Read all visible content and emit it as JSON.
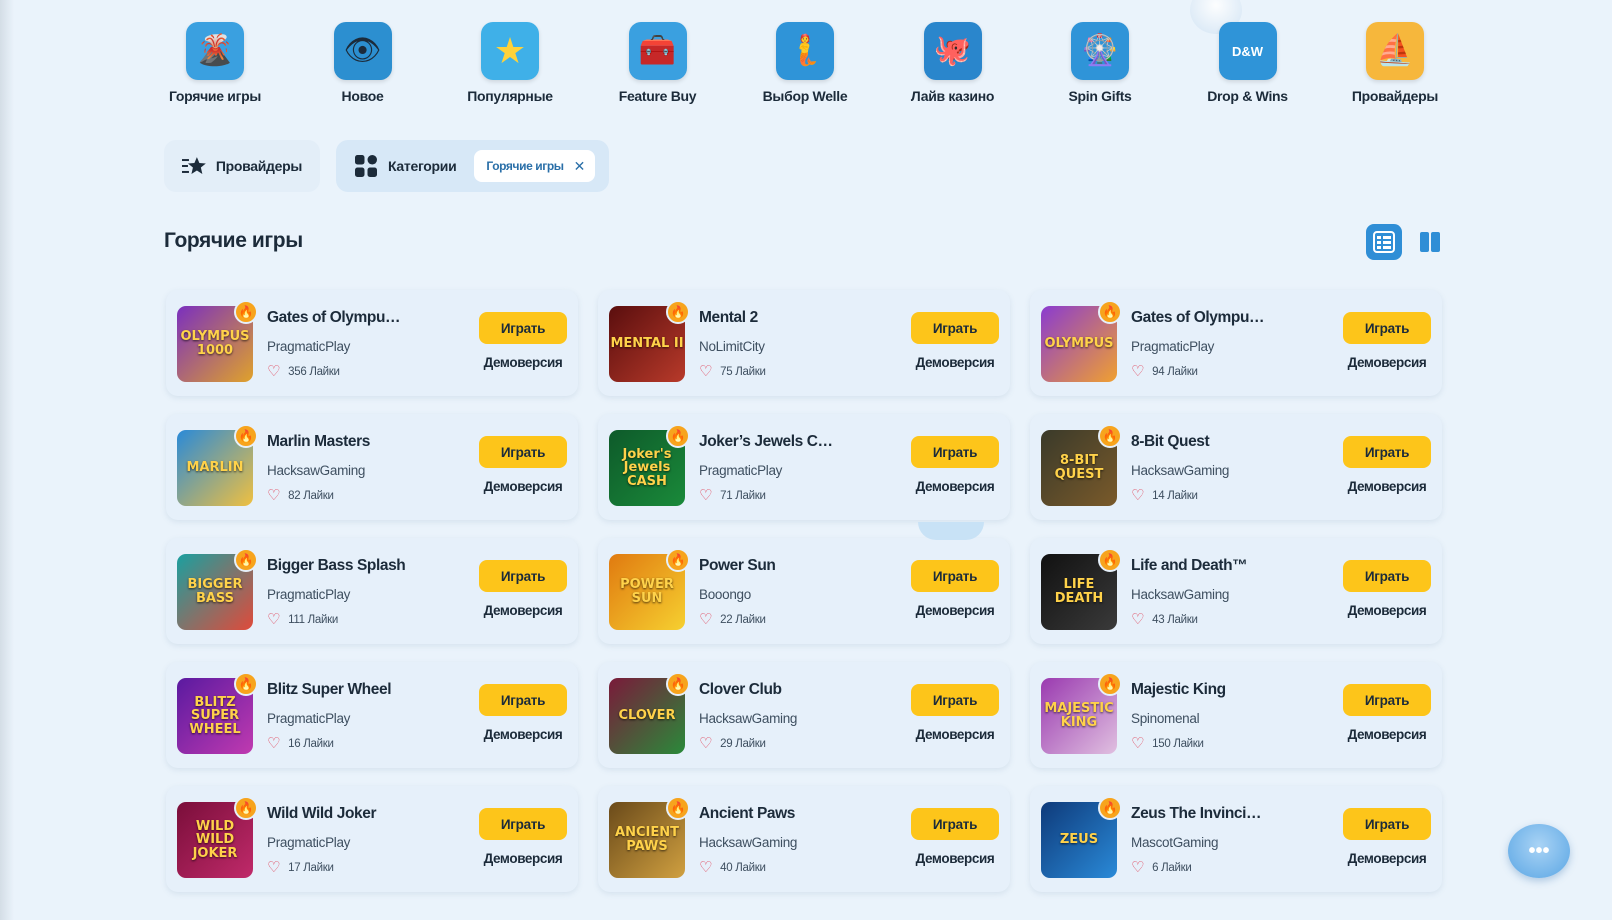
{
  "categories": [
    {
      "label": "Горячие игры",
      "icon": "volcano-icon",
      "glyph": "🌋",
      "bg": "#3aa0e0"
    },
    {
      "label": "Новое",
      "icon": "eye-icon",
      "glyph": "👁",
      "bg": "#2c8fd0"
    },
    {
      "label": "Популярные",
      "icon": "star-icon",
      "glyph": "★",
      "bg": "#3fb0e8"
    },
    {
      "label": "Feature Buy",
      "icon": "treasure-chest-icon",
      "glyph": "🧰",
      "bg": "#3aa0e0"
    },
    {
      "label": "Выбор Welle",
      "icon": "mermaid-icon",
      "glyph": "🧜",
      "bg": "#2f94d8"
    },
    {
      "label": "Лайв казино",
      "icon": "live-casino-icon",
      "glyph": "🐙",
      "bg": "#2a86cc"
    },
    {
      "label": "Spin Gifts",
      "icon": "wheel-icon",
      "glyph": "🎡",
      "bg": "#2f94d8"
    },
    {
      "label": "Drop & Wins",
      "icon": "drop-wins-icon",
      "glyph": "D&W",
      "bg": "#2f94d8"
    },
    {
      "label": "Провайдеры",
      "icon": "sailboat-icon",
      "glyph": "⛵",
      "bg": "#f6b73c"
    }
  ],
  "filters": {
    "providers_label": "Провайдеры",
    "categories_label": "Категории",
    "active_chip": "Горячие игры"
  },
  "section": {
    "title": "Горячие игры"
  },
  "play_label": "Играть",
  "demo_label": "Демоверсия",
  "games": [
    {
      "title": "Gates of Olympu…",
      "provider": "PragmaticPlay",
      "likes": "356 Лайки",
      "thumb_text": "OLYMPUS 1000",
      "thumb_bg": "linear-gradient(135deg,#7a2fbf,#e0a22a)"
    },
    {
      "title": "Mental 2",
      "provider": "NoLimitCity",
      "likes": "75 Лайки",
      "thumb_text": "MENTAL II",
      "thumb_bg": "linear-gradient(135deg,#5a0e0e,#b83a2a)"
    },
    {
      "title": "Gates of Olympu…",
      "provider": "PragmaticPlay",
      "likes": "94 Лайки",
      "thumb_text": "OLYMPUS",
      "thumb_bg": "linear-gradient(135deg,#8a3bd0,#f0a030)"
    },
    {
      "title": "Marlin Masters",
      "provider": "HacksawGaming",
      "likes": "82 Лайки",
      "thumb_text": "MARLIN",
      "thumb_bg": "linear-gradient(135deg,#2a8ad8,#f0c040)"
    },
    {
      "title": "Joker’s Jewels C…",
      "provider": "PragmaticPlay",
      "likes": "71 Лайки",
      "thumb_text": "Joker's Jewels CASH",
      "thumb_bg": "linear-gradient(135deg,#0e5a2a,#1a8a3a)"
    },
    {
      "title": "8-Bit Quest",
      "provider": "HacksawGaming",
      "likes": "14 Лайки",
      "thumb_text": "8-BIT QUEST",
      "thumb_bg": "linear-gradient(135deg,#3a3a2a,#7a5a2a)"
    },
    {
      "title": "Bigger Bass Splash",
      "provider": "PragmaticPlay",
      "likes": "111 Лайки",
      "thumb_text": "BIGGER BASS",
      "thumb_bg": "linear-gradient(135deg,#1aa0a0,#e04a3a)"
    },
    {
      "title": "Power Sun",
      "provider": "Booongo",
      "likes": "22 Лайки",
      "thumb_text": "POWER SUN",
      "thumb_bg": "linear-gradient(135deg,#e07a10,#f6d030)"
    },
    {
      "title": "Life and Death™",
      "provider": "HacksawGaming",
      "likes": "43 Лайки",
      "thumb_text": "LIFE DEATH",
      "thumb_bg": "linear-gradient(135deg,#111111,#3a3a3a)"
    },
    {
      "title": "Blitz Super Wheel",
      "provider": "PragmaticPlay",
      "likes": "16 Лайки",
      "thumb_text": "BLITZ SUPER WHEEL",
      "thumb_bg": "linear-gradient(135deg,#5a1aa0,#c03ab0)"
    },
    {
      "title": "Clover Club",
      "provider": "HacksawGaming",
      "likes": "29 Лайки",
      "thumb_text": "CLOVER",
      "thumb_bg": "linear-gradient(135deg,#7a1a3a,#2a8a3a)"
    },
    {
      "title": "Majestic King",
      "provider": "Spinomenal",
      "likes": "150 Лайки",
      "thumb_text": "MAJESTIC KING",
      "thumb_bg": "linear-gradient(135deg,#9a3ab0,#e0c0e0)"
    },
    {
      "title": "Wild Wild Joker",
      "provider": "PragmaticPlay",
      "likes": "17 Лайки",
      "thumb_text": "WILD WILD JOKER",
      "thumb_bg": "linear-gradient(135deg,#7a0e3a,#c02a6a)"
    },
    {
      "title": "Ancient Paws",
      "provider": "HacksawGaming",
      "likes": "40 Лайки",
      "thumb_text": "ANCIENT PAWS",
      "thumb_bg": "linear-gradient(135deg,#6a4a1a,#d0a040)"
    },
    {
      "title": "Zeus The Invinci…",
      "provider": "MascotGaming",
      "likes": "6 Лайки",
      "thumb_text": "ZEUS",
      "thumb_bg": "linear-gradient(135deg,#0e3a7a,#2a8ad8)"
    }
  ],
  "colors": {
    "accent": "#2f8ed6",
    "play_button": "#fdc51a",
    "heart": "#e0445a",
    "card_bg": "#e6f0fa"
  }
}
